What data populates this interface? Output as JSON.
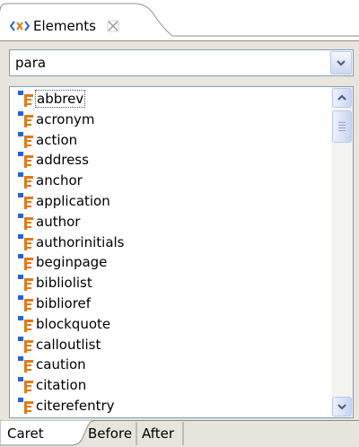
{
  "view": {
    "title": "Elements",
    "icon": "xml-tag-icon",
    "close_icon": "close-icon"
  },
  "combo": {
    "value": "para",
    "button_icon": "chevron-down-icon"
  },
  "elements": [
    "abbrev",
    "acronym",
    "action",
    "address",
    "anchor",
    "application",
    "author",
    "authorinitials",
    "beginpage",
    "bibliolist",
    "biblioref",
    "blockquote",
    "calloutlist",
    "caution",
    "citation",
    "citerefentry"
  ],
  "selected_element": "abbrev",
  "bottom_tabs": [
    {
      "label": "Caret",
      "active": true
    },
    {
      "label": "Before",
      "active": false
    },
    {
      "label": "After",
      "active": false
    }
  ],
  "colors": {
    "panel_bg": "#e8e5dc",
    "border": "#7f9db9",
    "icon_blue": "#2a5fd8",
    "icon_orange": "#e07a1a"
  }
}
